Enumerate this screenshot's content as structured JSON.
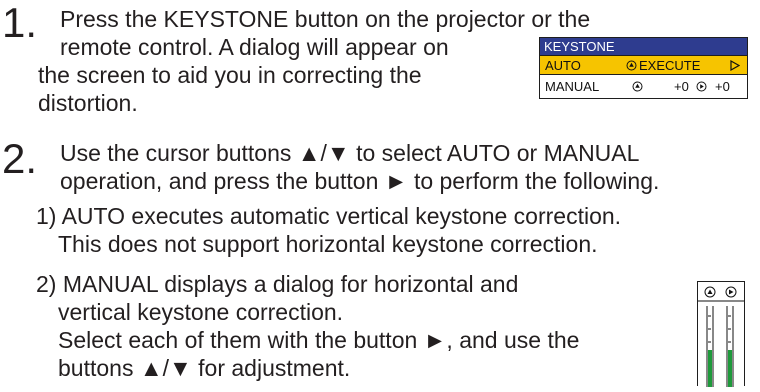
{
  "step1": {
    "number": "1.",
    "lines": [
      "Press the KEYSTONE button on the projector or the",
      "remote control. A dialog will appear on",
      "the screen to aid you in correcting the",
      "distortion."
    ]
  },
  "dialog": {
    "title": "KEYSTONE",
    "auto_label": "AUTO",
    "execute_label": "EXECUTE",
    "manual_label": "MANUAL",
    "value_1": "+0",
    "value_2": "+0"
  },
  "step2": {
    "number": "2.",
    "lines": [
      "Use the cursor buttons ▲/▼ to select AUTO or MANUAL",
      "operation, and press the button ► to perform the following."
    ],
    "sub1": [
      "1)  AUTO executes automatic vertical keystone correction.",
      "This does not support horizontal keystone correction."
    ],
    "sub2": [
      "2)  MANUAL displays a dialog for horizontal and",
      "vertical keystone correction.",
      "Select each of them with the button ►, and use the",
      "buttons ▲/▼ for adjustment."
    ]
  },
  "colors": {
    "text": "#231f20",
    "dialog_title_bg": "#2e3c8f",
    "dialog_highlight": "#f6c400",
    "slider_green": "#1f9a3c"
  }
}
